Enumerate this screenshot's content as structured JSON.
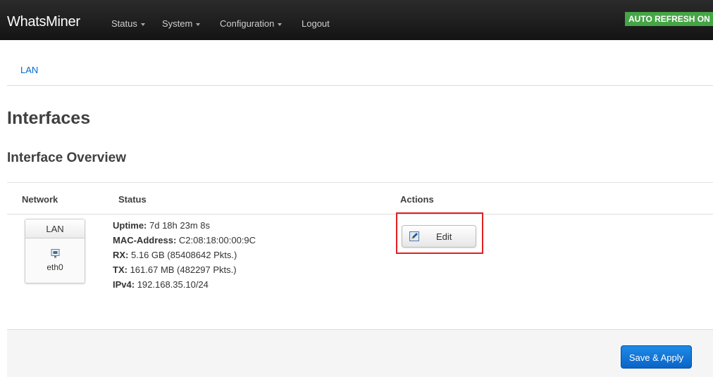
{
  "navbar": {
    "brand": "WhatsMiner",
    "menu": [
      {
        "label": "Status"
      },
      {
        "label": "System"
      },
      {
        "label": "Configuration"
      },
      {
        "label": "Logout"
      }
    ],
    "auto_refresh": "AUTO REFRESH ON",
    "auto_refresh_color": "#46a546"
  },
  "tabs": [
    {
      "label": "LAN"
    }
  ],
  "page": {
    "title": "Interfaces",
    "section_title": "Interface Overview"
  },
  "table": {
    "headers": {
      "network": "Network",
      "status": "Status",
      "actions": "Actions"
    },
    "rows": [
      {
        "network": {
          "name": "LAN",
          "device": "eth0",
          "icon": "ethernet-port-icon"
        },
        "status": {
          "uptime_label": "Uptime:",
          "uptime_value": " 7d 18h 23m 8s",
          "mac_label": "MAC-Address:",
          "mac_value": " C2:08:18:00:00:9C",
          "rx_label": "RX:",
          "rx_value": " 5.16 GB (85408642 Pkts.)",
          "tx_label": "TX:",
          "tx_value": " 161.67 MB (482297 Pkts.)",
          "ipv4_label": "IPv4:",
          "ipv4_value": " 192.168.35.10/24"
        },
        "actions": {
          "edit_label": "Edit",
          "edit_icon": "edit-pencil-icon"
        }
      }
    ]
  },
  "footer": {
    "save_apply_label": "Save & Apply"
  },
  "colors": {
    "navbar_bg": "#1e1e1e",
    "link": "#0069d6",
    "highlight": "#e02020",
    "primary_button": "#0a64c8"
  }
}
